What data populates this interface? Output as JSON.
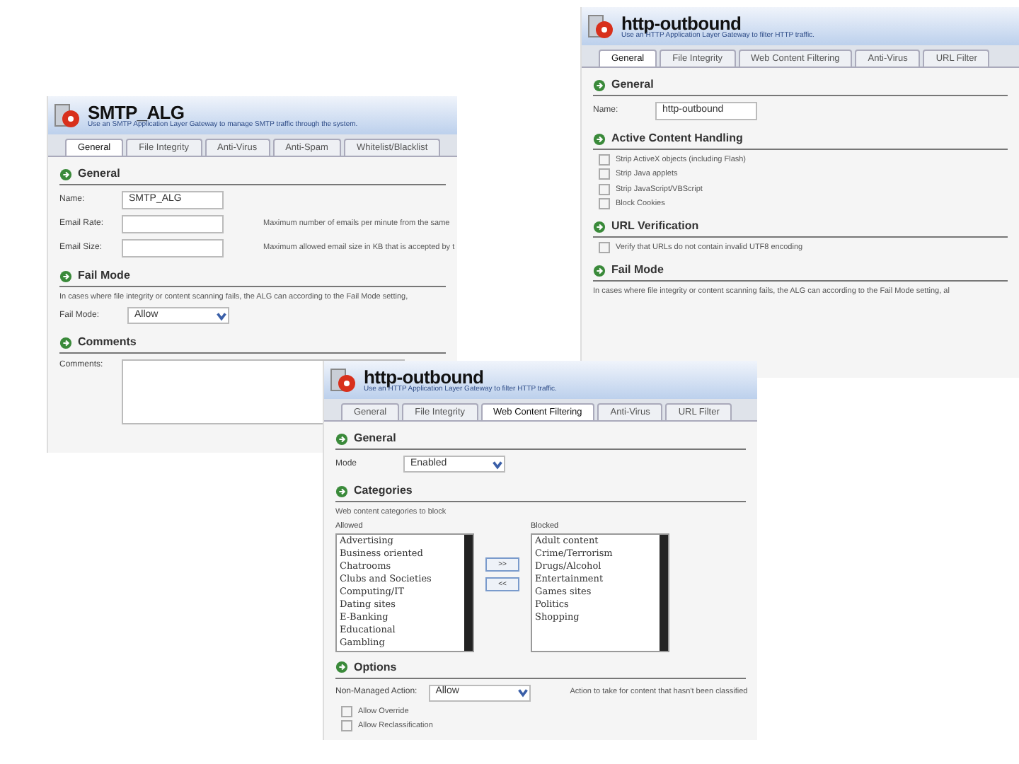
{
  "windows": [
    {
      "title": "SMTP_ALG",
      "subtitle": "Use an SMTP Application Layer Gateway to manage SMTP traffic through the system.",
      "tabs": [
        {
          "label": "General",
          "selected": true
        },
        {
          "label": "File Integrity",
          "selected": false
        },
        {
          "label": "Anti-Virus",
          "selected": false
        },
        {
          "label": "Anti-Spam",
          "selected": false
        },
        {
          "label": "Whitelist/Blacklist",
          "selected": false
        }
      ],
      "sections": [
        {
          "heading": "General",
          "rows": [
            {
              "kind": "field",
              "label": "Name:",
              "value": "SMTP_ALG"
            },
            {
              "kind": "field",
              "label": "Email Rate:",
              "note": "Maximum number of emails per minute from the same"
            },
            {
              "kind": "field",
              "label": "Email Size:",
              "note": "Maximum allowed email size in KB that is accepted by t"
            }
          ]
        },
        {
          "heading": "Fail Mode",
          "rows": [
            {
              "kind": "text",
              "text": "In cases where file integrity or content scanning fails, the ALG can according to the Fail Mode setting,"
            },
            {
              "kind": "select",
              "label": "Fail Mode:",
              "value": "Allow"
            }
          ]
        },
        {
          "heading": "Comments",
          "rows": [
            {
              "kind": "textarea",
              "label": "Comments:"
            }
          ]
        }
      ]
    },
    {
      "title": "http-outbound",
      "subtitle": "Use an HTTP Application Layer Gateway to filter HTTP traffic.",
      "tabs": [
        {
          "label": "General",
          "selected": true
        },
        {
          "label": "File Integrity",
          "selected": false
        },
        {
          "label": "Web Content Filtering",
          "selected": false
        },
        {
          "label": "Anti-Virus",
          "selected": false
        },
        {
          "label": "URL Filter",
          "selected": false
        }
      ],
      "sections": [
        {
          "heading": "General",
          "rows": [
            {
              "kind": "field",
              "label": "Name:",
              "value": "http-outbound"
            }
          ]
        },
        {
          "heading": "Active Content Handling",
          "rows": [
            {
              "kind": "checkbox",
              "label": "Strip ActiveX objects (including Flash)",
              "checked": false
            },
            {
              "kind": "checkbox",
              "label": "Strip Java applets",
              "checked": false
            },
            {
              "kind": "checkbox",
              "label": "Strip JavaScript/VBScript",
              "checked": false
            },
            {
              "kind": "checkbox",
              "label": "Block Cookies",
              "checked": false
            }
          ]
        },
        {
          "heading": "URL Verification",
          "rows": [
            {
              "kind": "checkbox",
              "label": "Verify that URLs do not contain invalid UTF8 encoding",
              "checked": false
            }
          ]
        },
        {
          "heading": "Fail Mode",
          "rows": [
            {
              "kind": "text",
              "text": "In cases where file integrity or content scanning fails, the ALG can according to the Fail Mode setting, al"
            }
          ]
        }
      ]
    },
    {
      "title": "http-outbound",
      "subtitle": "Use an HTTP Application Layer Gateway to filter HTTP traffic.",
      "tabs": [
        {
          "label": "General",
          "selected": false
        },
        {
          "label": "File Integrity",
          "selected": false
        },
        {
          "label": "Web Content Filtering",
          "selected": true
        },
        {
          "label": "Anti-Virus",
          "selected": false
        },
        {
          "label": "URL Filter",
          "selected": false
        }
      ],
      "sections": [
        {
          "heading": "General",
          "rows": [
            {
              "kind": "select",
              "label": "Mode",
              "value": "Enabled"
            }
          ]
        },
        {
          "heading": "Categories",
          "rows": [
            {
              "kind": "text",
              "text": "Web content categories to block"
            },
            {
              "kind": "lists",
              "allowed_label": "Allowed",
              "allowed": [
                "Advertising",
                "Business oriented",
                "Chatrooms",
                "Clubs and Societies",
                "Computing/IT",
                "Dating sites",
                "E-Banking",
                "Educational",
                "Gambling"
              ],
              "blocked_label": "Blocked",
              "blocked": [
                "Adult content",
                "Crime/Terrorism",
                "Drugs/Alcohol",
                "Entertainment",
                "Games sites",
                "Politics",
                "Shopping"
              ],
              "buttons": [
                ">>",
                "<<"
              ]
            }
          ]
        },
        {
          "heading": "Options",
          "rows": [
            {
              "kind": "select",
              "label": "Non-Managed Action:",
              "value": "Allow",
              "note": "Action to take for content that hasn't been classified"
            },
            {
              "kind": "checkbox",
              "label": "Allow Override",
              "checked": false
            },
            {
              "kind": "checkbox",
              "label": "Allow Reclassification",
              "checked": false
            }
          ]
        }
      ]
    }
  ]
}
